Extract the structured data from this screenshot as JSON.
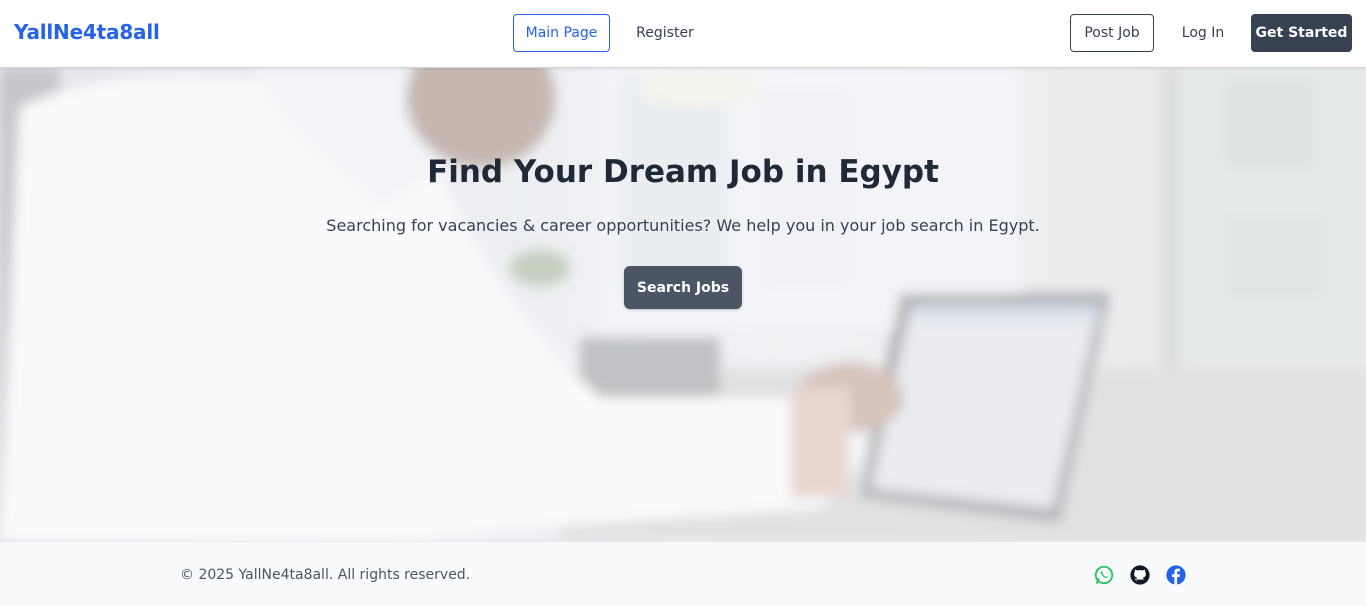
{
  "header": {
    "brand": "YallNe4ta8all",
    "nav": {
      "main_page": "Main Page",
      "register": "Register"
    },
    "actions": {
      "post_job": "Post Job",
      "log_in": "Log In",
      "get_started": "Get Started"
    }
  },
  "hero": {
    "title": "Find Your Dream Job in Egypt",
    "subtitle": "Searching for vacancies & career opportunities? We help you in your job search in Egypt.",
    "cta": "Search Jobs"
  },
  "footer": {
    "copyright": "© 2025 YallNe4ta8all. All rights reserved.",
    "social": [
      {
        "icon": "whatsapp-icon",
        "color": "#22c55e"
      },
      {
        "icon": "github-icon",
        "color": "#111827"
      },
      {
        "icon": "facebook-icon",
        "color": "#2563eb"
      }
    ]
  },
  "colors": {
    "brand": "#2563eb",
    "dark_button": "#374151",
    "hero_button": "#4b5563"
  }
}
